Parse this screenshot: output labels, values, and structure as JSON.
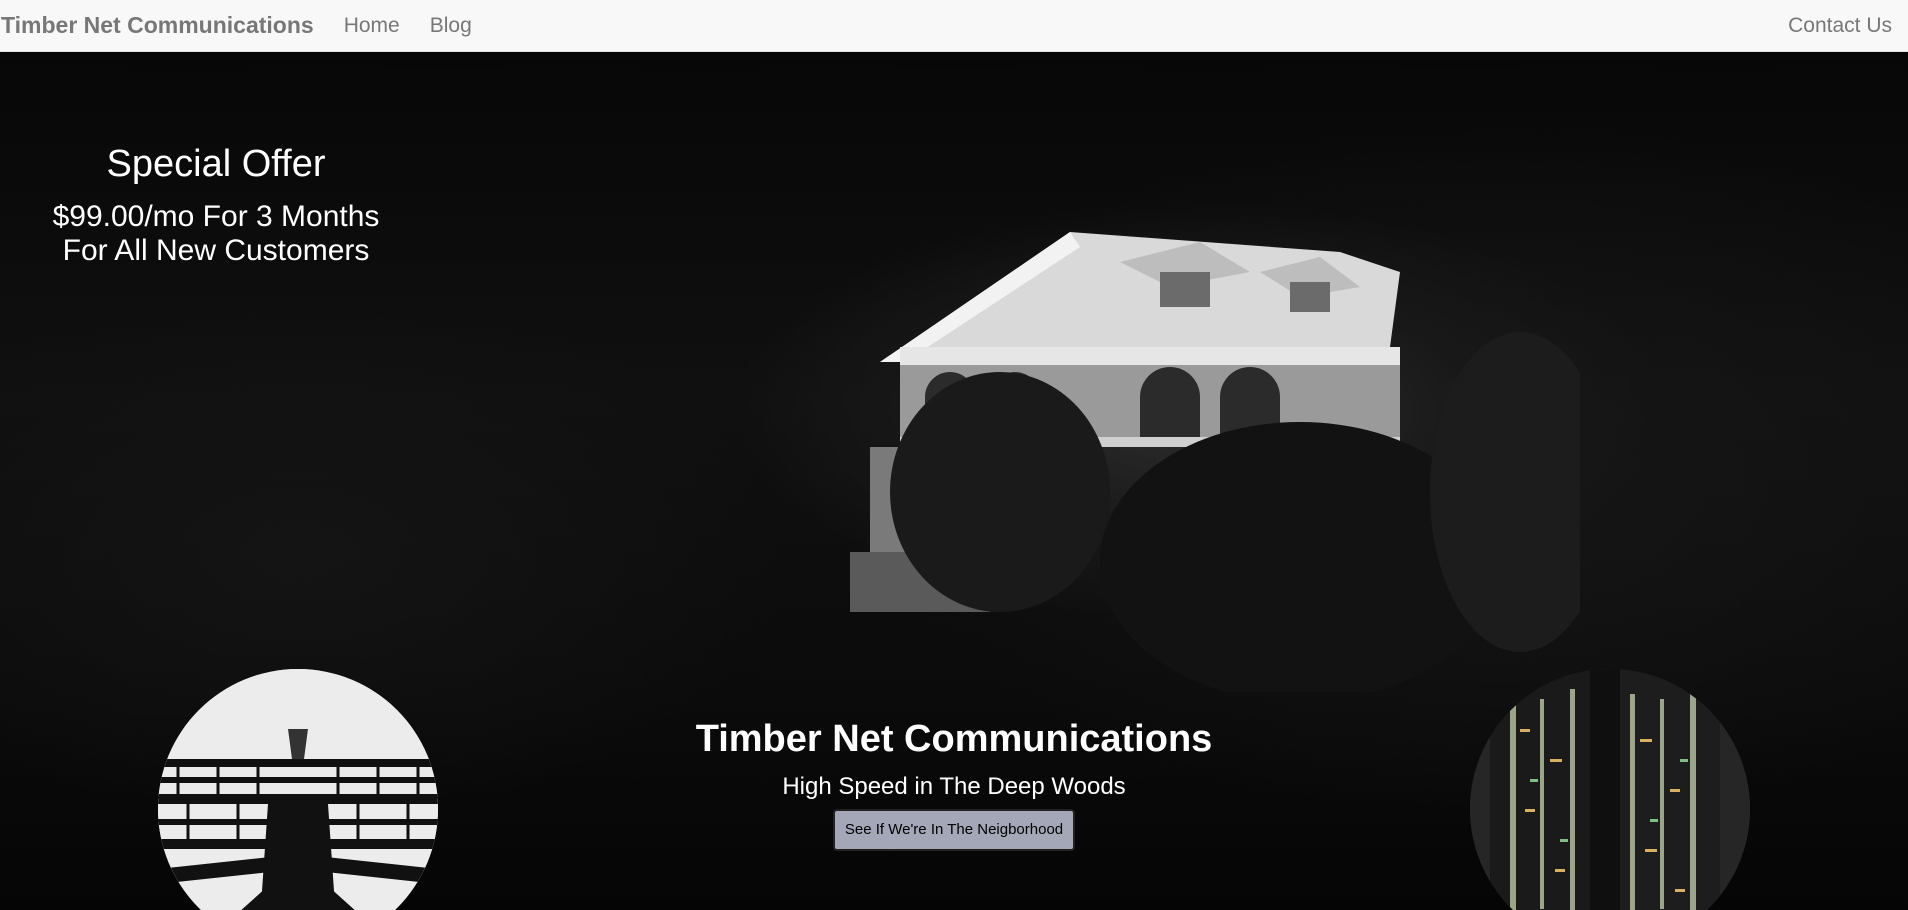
{
  "navbar": {
    "brand": "Timber Net Communications",
    "links": [
      "Home",
      "Blog"
    ],
    "contact": "Contact Us"
  },
  "offer": {
    "title": "Special Offer",
    "line1": "$99.00/mo For 3 Months",
    "line2": "For All New Customers"
  },
  "hero": {
    "title": "Timber Net Communications",
    "subtitle": "High Speed in The Deep Woods",
    "cta": "See If We're In The Neigborhood"
  },
  "colors": {
    "navbar_bg": "#f8f8f8",
    "nav_text": "#777777",
    "cta_bg": "#a3a7b7"
  }
}
